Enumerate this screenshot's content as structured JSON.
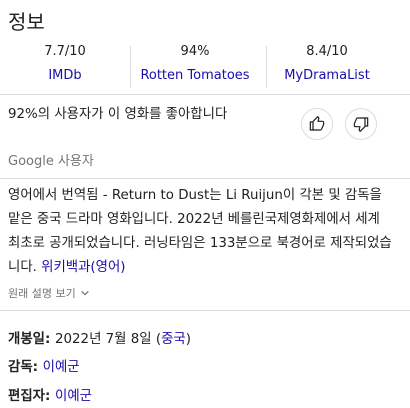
{
  "title": "정보",
  "ratings": [
    {
      "score": "7.7/10",
      "source": "IMDb"
    },
    {
      "score": "94%",
      "source": "Rotten Tomatoes"
    },
    {
      "score": "8.4/10",
      "source": "MyDramaList"
    }
  ],
  "audience": {
    "like_text": "92%의 사용자가 이 영화를 좋아합니다",
    "source": "Google 사용자",
    "like_icon": "thumbs-up-icon",
    "dislike_icon": "thumbs-down-icon"
  },
  "description": {
    "text": "영어에서 번역됨 - Return to Dust는 Li Ruijun이 각본 및 감독을 맡은 중국 드라마 영화입니다. 2022년 베를린국제영화제에서 세계 최초로 공개되었습니다. 러닝타임은 133분으로 북경어로 제작되었습니다. ",
    "link": "위키백과(영어)",
    "more_label": "원래 설명 보기",
    "more_icon": "chevron-down-icon"
  },
  "facts": {
    "release": {
      "label": "개봉일",
      "value": "2022년 7월 8일 (",
      "link": "중국",
      "close": ")"
    },
    "director": {
      "label": "감독",
      "link": "이예군"
    },
    "editor": {
      "label": "편집자",
      "link": "이예군"
    }
  },
  "colors": {
    "link": "#1a0dab",
    "text": "#202124",
    "muted": "#70757a",
    "divider": "#dadce0"
  }
}
